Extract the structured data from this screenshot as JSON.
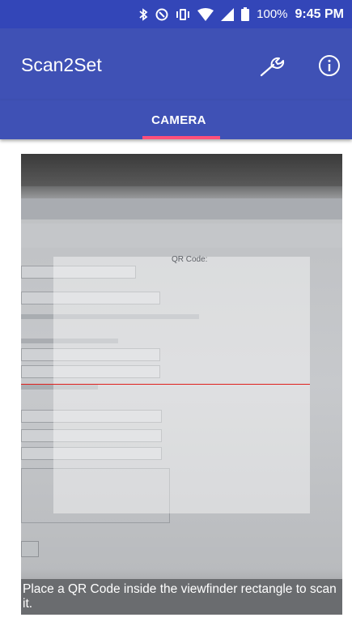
{
  "status_bar": {
    "icons": [
      "bluetooth-icon",
      "nfc-icon",
      "vibrate-icon",
      "wifi-icon",
      "cell-signal-icon",
      "battery-icon"
    ],
    "battery": "100%",
    "time": "9:45 PM"
  },
  "app_bar": {
    "title": "Scan2Set",
    "settings_icon": "wrench-icon",
    "info_icon": "info-icon"
  },
  "tabs": [
    {
      "label": "CAMERA",
      "selected": true
    }
  ],
  "camera": {
    "overlay_label": "QR Code:",
    "hint": "Place a QR Code inside the viewfinder rectangle to scan it."
  },
  "colors": {
    "primary": "#3f51b5",
    "status_bar": "#3346b8",
    "tab_indicator": "#ff4f7a",
    "laser": "#e0201d"
  }
}
